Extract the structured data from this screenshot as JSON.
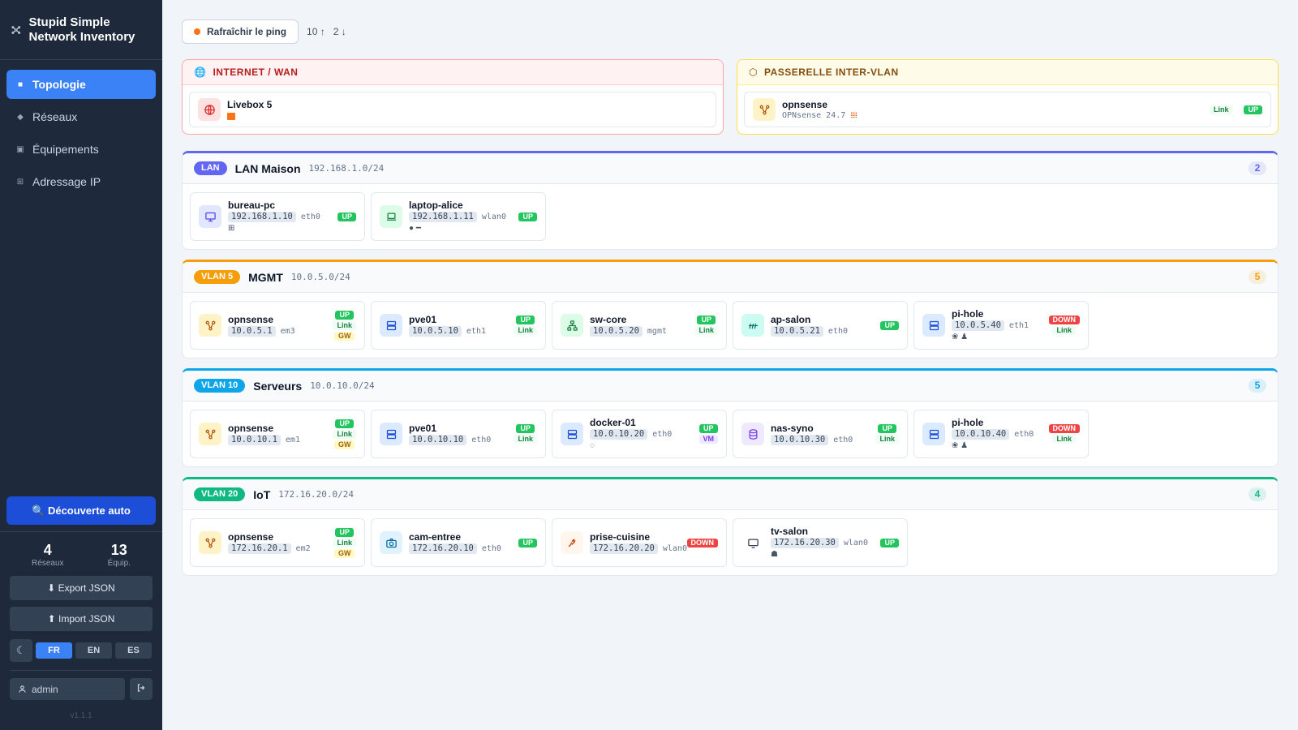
{
  "app": {
    "title": "Stupid Simple Network Inventory",
    "version": "v1.1.1"
  },
  "nav": {
    "items": [
      {
        "label": "Topologie",
        "icon": "square-icon",
        "active": true
      },
      {
        "label": "Réseaux",
        "icon": "diamond-icon",
        "active": false
      },
      {
        "label": "Équipements",
        "icon": "box-icon",
        "active": false
      },
      {
        "label": "Adressage IP",
        "icon": "grid-icon",
        "active": false
      }
    ]
  },
  "discover_label": "🔍 Découverte auto",
  "stats": {
    "networks_value": "4",
    "networks_label": "Réseaux",
    "devices_value": "13",
    "devices_label": "Équip."
  },
  "export_label": "⬇ Export JSON",
  "import_label": "⬆ Import JSON",
  "theme_icon": "☾",
  "languages": [
    "FR",
    "EN",
    "ES"
  ],
  "active_language": "FR",
  "user": {
    "name": "admin"
  },
  "toolbar": {
    "refresh_label": "Rafraîchir le ping",
    "up_count": "10 ↑",
    "down_count": "2 ↓"
  },
  "wan": {
    "title": "INTERNET / WAN",
    "device": {
      "name": "Livebox 5"
    }
  },
  "gateway": {
    "title": "PASSERELLE INTER-VLAN",
    "device": {
      "name": "opnsense",
      "os": "OPNsense 24.7",
      "link": "Link",
      "status": "UP"
    }
  },
  "colors": {
    "accent": "#3b82f6",
    "up": "#22c55e",
    "down": "#ef4444",
    "lan": "#6366f1",
    "vlan5": "#f59e0b",
    "vlan10": "#0ea5e9",
    "vlan20": "#10b981"
  },
  "networks": [
    {
      "tag": "LAN",
      "name": "LAN Maison",
      "cidr": "192.168.1.0/24",
      "count": "2",
      "devices": [
        {
          "name": "bureau-pc",
          "ip": "192.168.1.10",
          "iface": "eth0",
          "os": "⊞",
          "status": "UP",
          "icon": "monitor-icon"
        },
        {
          "name": "laptop-alice",
          "ip": "192.168.1.11",
          "iface": "wlan0",
          "os": "● ━",
          "status": "UP",
          "icon": "laptop-icon"
        }
      ]
    },
    {
      "tag": "VLAN 5",
      "name": "MGMT",
      "cidr": "10.0.5.0/24",
      "count": "5",
      "devices": [
        {
          "name": "opnsense",
          "ip": "10.0.5.1",
          "iface": "em3",
          "status": "UP",
          "link": "Link",
          "gw": "GW",
          "icon": "router-icon"
        },
        {
          "name": "pve01",
          "ip": "10.0.5.10",
          "iface": "eth1",
          "status": "UP",
          "link": "Link",
          "icon": "server-icon"
        },
        {
          "name": "sw-core",
          "ip": "10.0.5.20",
          "iface": "mgmt",
          "status": "UP",
          "link": "Link",
          "icon": "switch-icon"
        },
        {
          "name": "ap-salon",
          "ip": "10.0.5.21",
          "iface": "eth0",
          "status": "UP",
          "icon": "wifi-icon"
        },
        {
          "name": "pi-hole",
          "ip": "10.0.5.40",
          "iface": "eth1",
          "os": "❀ ♟",
          "status": "DOWN",
          "link": "Link",
          "icon": "server-icon"
        }
      ]
    },
    {
      "tag": "VLAN 10",
      "name": "Serveurs",
      "cidr": "10.0.10.0/24",
      "count": "5",
      "devices": [
        {
          "name": "opnsense",
          "ip": "10.0.10.1",
          "iface": "em1",
          "status": "UP",
          "link": "Link",
          "gw": "GW",
          "icon": "router-icon"
        },
        {
          "name": "pve01",
          "ip": "10.0.10.10",
          "iface": "eth0",
          "status": "UP",
          "link": "Link",
          "icon": "server-icon"
        },
        {
          "name": "docker-01",
          "ip": "10.0.10.20",
          "iface": "eth0",
          "os": "◌",
          "status": "UP",
          "vm": "VM",
          "icon": "server-icon"
        },
        {
          "name": "nas-syno",
          "ip": "10.0.10.30",
          "iface": "eth0",
          "status": "UP",
          "link": "Link",
          "icon": "database-icon"
        },
        {
          "name": "pi-hole",
          "ip": "10.0.10.40",
          "iface": "eth0",
          "os": "❀ ♟",
          "status": "DOWN",
          "link": "Link",
          "icon": "server-icon"
        }
      ]
    },
    {
      "tag": "VLAN 20",
      "name": "IoT",
      "cidr": "172.16.20.0/24",
      "count": "4",
      "devices": [
        {
          "name": "opnsense",
          "ip": "172.16.20.1",
          "iface": "em2",
          "status": "UP",
          "link": "Link",
          "gw": "GW",
          "icon": "router-icon"
        },
        {
          "name": "cam-entree",
          "ip": "172.16.20.10",
          "iface": "eth0",
          "status": "UP",
          "icon": "camera-icon"
        },
        {
          "name": "prise-cuisine",
          "ip": "172.16.20.20",
          "iface": "wlan0",
          "status": "DOWN",
          "icon": "plug-icon"
        },
        {
          "name": "tv-salon",
          "ip": "172.16.20.30",
          "iface": "wlan0",
          "os": "☗",
          "status": "UP",
          "icon": "tv-icon"
        }
      ]
    }
  ]
}
